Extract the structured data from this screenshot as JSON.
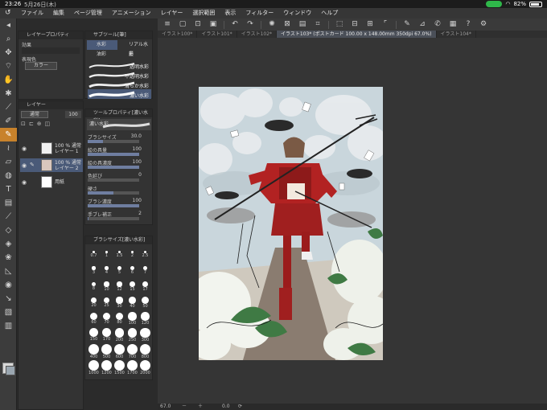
{
  "status": {
    "time": "23:26",
    "date": "5月26日(木)",
    "battery": "82%"
  },
  "menu": [
    "ファイル",
    "編集",
    "ページ管理",
    "アニメーション",
    "レイヤー",
    "選択範囲",
    "表示",
    "フィルター",
    "ウィンドウ",
    "ヘルプ"
  ],
  "tabs": [
    {
      "label": "イラスト100*",
      "active": false
    },
    {
      "label": "イラスト101*",
      "active": false
    },
    {
      "label": "イラスト102*",
      "active": false
    },
    {
      "label": "イラスト103* (ポストカード 100.00 x 148.00mm 350dpi 67.0%)",
      "active": true
    },
    {
      "label": "イラスト104*",
      "active": false
    }
  ],
  "layer_property": {
    "title": "レイヤープロパティ",
    "effect_label": "効果",
    "expression_label": "表現色",
    "expression_value": "カラー"
  },
  "layers_panel": {
    "title": "レイヤー",
    "blend_mode": "通常",
    "opacity": "100",
    "items": [
      {
        "percent": "100 %",
        "mode": "通常",
        "name": "レイヤー 1",
        "selected": false
      },
      {
        "percent": "100 %",
        "mode": "通常",
        "name": "レイヤー 2",
        "selected": true
      },
      {
        "percent": "",
        "mode": "",
        "name": "用紙",
        "selected": false
      }
    ]
  },
  "subtool": {
    "title": "サブツール[筆]",
    "groups": [
      "水彩",
      "リアル水彩",
      "油彩",
      "墨"
    ],
    "brushes": [
      "透明水彩",
      "不透明水彩",
      "滑らか水彩",
      "濃い水彩"
    ]
  },
  "tool_property": {
    "title": "ツールプロパティ[濃い水彩]",
    "brush_name": "濃い水彩",
    "rows": [
      {
        "label": "ブラシサイズ",
        "value": "30.0",
        "level": 0.3
      },
      {
        "label": "絵の具量",
        "value": "100",
        "level": 1.0
      },
      {
        "label": "絵の具濃度",
        "value": "100",
        "level": 1.0
      },
      {
        "label": "色延び",
        "value": "0",
        "level": 0.0
      },
      {
        "label": "硬さ",
        "value": "",
        "level": 0.5
      },
      {
        "label": "ブラシ濃度",
        "value": "100",
        "level": 1.0
      },
      {
        "label": "手ブレ補正",
        "value": "2",
        "level": 0.02
      }
    ]
  },
  "brush_size": {
    "title": "ブラシサイズ[濃い水彩]",
    "sizes": [
      "0.7",
      "1",
      "1.5",
      "2",
      "2.5",
      "3",
      "4",
      "5",
      "6",
      "7",
      "8",
      "10",
      "12",
      "15",
      "17",
      "20",
      "25",
      "30",
      "40",
      "50",
      "60",
      "70",
      "80",
      "100",
      "120",
      "150",
      "170",
      "200",
      "250",
      "300",
      "400",
      "500",
      "600",
      "700",
      "800",
      "1000",
      "1200",
      "1500",
      "1700",
      "2000"
    ]
  },
  "bottom": {
    "zoom": "67.0",
    "angle": "0.0"
  },
  "colors": {
    "accent": "#c8822b",
    "selection": "#4a5a78",
    "armor": "#b22222"
  }
}
